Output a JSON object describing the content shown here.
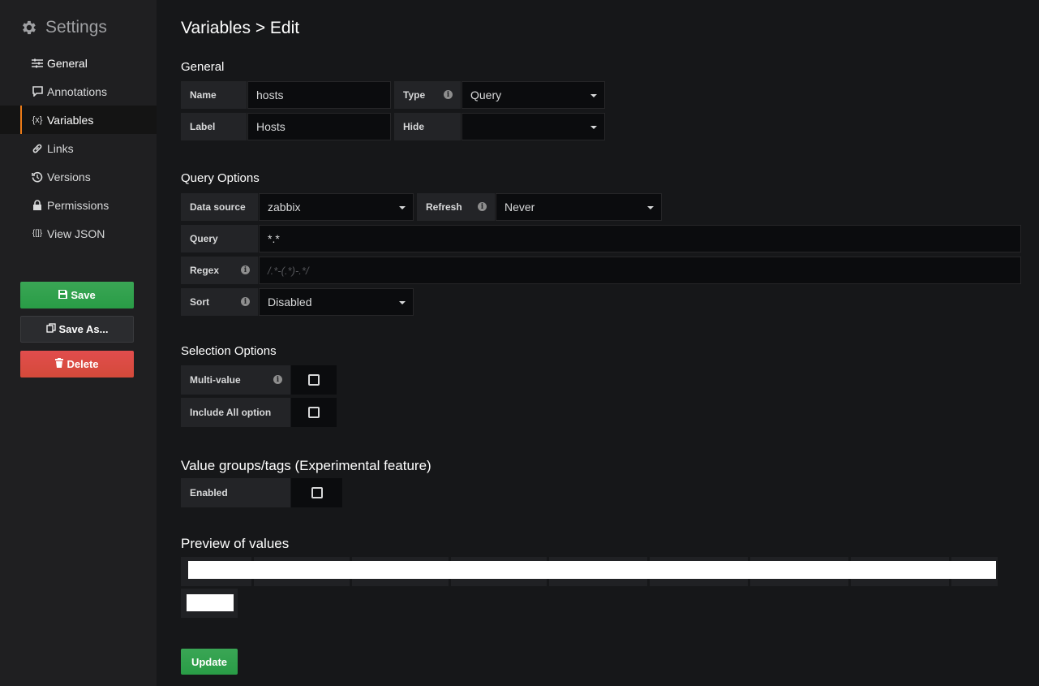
{
  "sidebar": {
    "title": "Settings",
    "items": [
      {
        "label": "General",
        "icon": "sliders-icon"
      },
      {
        "label": "Annotations",
        "icon": "comment-icon"
      },
      {
        "label": "Variables",
        "icon": "variable-icon"
      },
      {
        "label": "Links",
        "icon": "link-icon"
      },
      {
        "label": "Versions",
        "icon": "history-icon"
      },
      {
        "label": "Permissions",
        "icon": "lock-icon"
      },
      {
        "label": "View JSON",
        "icon": "json-icon"
      }
    ],
    "save_label": "Save",
    "save_as_label": "Save As...",
    "delete_label": "Delete"
  },
  "page": {
    "title": "Variables > Edit"
  },
  "general": {
    "heading": "General",
    "name_label": "Name",
    "name_value": "hosts",
    "type_label": "Type",
    "type_value": "Query",
    "label_label": "Label",
    "label_value": "Hosts",
    "hide_label": "Hide",
    "hide_value": ""
  },
  "query_options": {
    "heading": "Query Options",
    "datasource_label": "Data source",
    "datasource_value": "zabbix",
    "refresh_label": "Refresh",
    "refresh_value": "Never",
    "query_label": "Query",
    "query_value": "*.*",
    "regex_label": "Regex",
    "regex_placeholder": "/.*-(.*)-.*/",
    "sort_label": "Sort",
    "sort_value": "Disabled"
  },
  "selection_options": {
    "heading": "Selection Options",
    "multi_label": "Multi-value",
    "multi_checked": false,
    "include_all_label": "Include All option",
    "include_all_checked": false
  },
  "value_groups": {
    "heading": "Value groups/tags (Experimental feature)",
    "enabled_label": "Enabled",
    "enabled_checked": false
  },
  "preview": {
    "heading": "Preview of values"
  },
  "update_label": "Update",
  "colors": {
    "accent": "#eb7b18",
    "save": "#299c46",
    "delete": "#d44a3a"
  }
}
